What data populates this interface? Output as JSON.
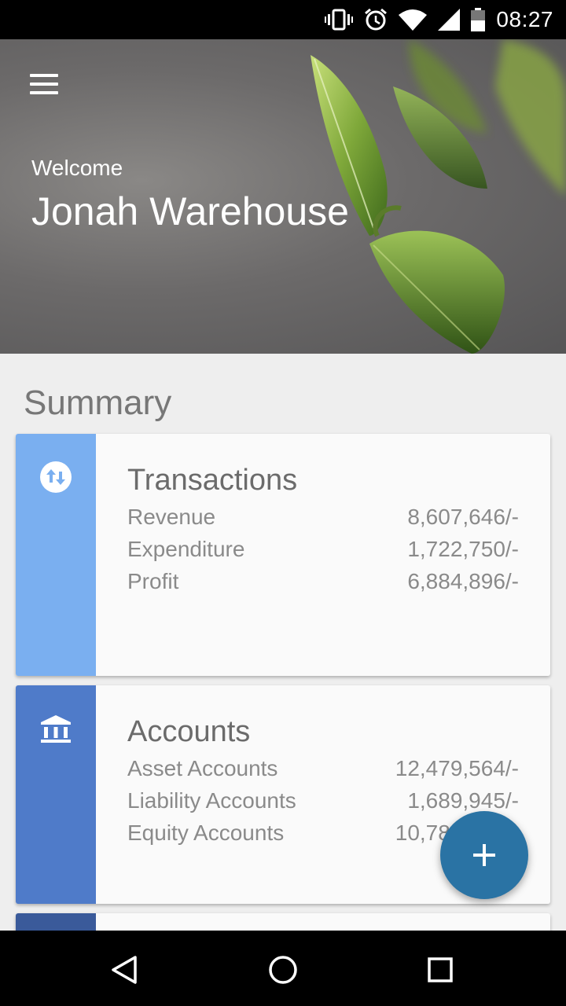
{
  "status_bar": {
    "time": "08:27",
    "icons": [
      "vibrate-icon",
      "alarm-icon",
      "wifi-icon",
      "signal-icon",
      "battery-icon"
    ]
  },
  "header": {
    "menu_icon": "hamburger-menu-icon",
    "welcome": "Welcome",
    "user_name": "Jonah Warehouse"
  },
  "summary": {
    "title": "Summary",
    "cards": [
      {
        "title": "Transactions",
        "icon": "swap-vertical-icon",
        "accent": "#7aaff0",
        "rows": [
          {
            "label": "Revenue",
            "value": "8,607,646/-"
          },
          {
            "label": "Expenditure",
            "value": "1,722,750/-"
          },
          {
            "label": "Profit",
            "value": "6,884,896/-"
          }
        ]
      },
      {
        "title": "Accounts",
        "icon": "bank-icon",
        "accent": "#4f7bc9",
        "rows": [
          {
            "label": "Asset Accounts",
            "value": "12,479,564/-"
          },
          {
            "label": "Liability Accounts",
            "value": "1,689,945/-"
          },
          {
            "label": "Equity Accounts",
            "value": "10,789,619/-"
          }
        ]
      }
    ]
  },
  "fab": {
    "icon": "plus-icon",
    "color": "#2a73a4"
  },
  "nav_bar": {
    "icons": [
      "back-icon",
      "home-icon",
      "recents-icon"
    ]
  }
}
